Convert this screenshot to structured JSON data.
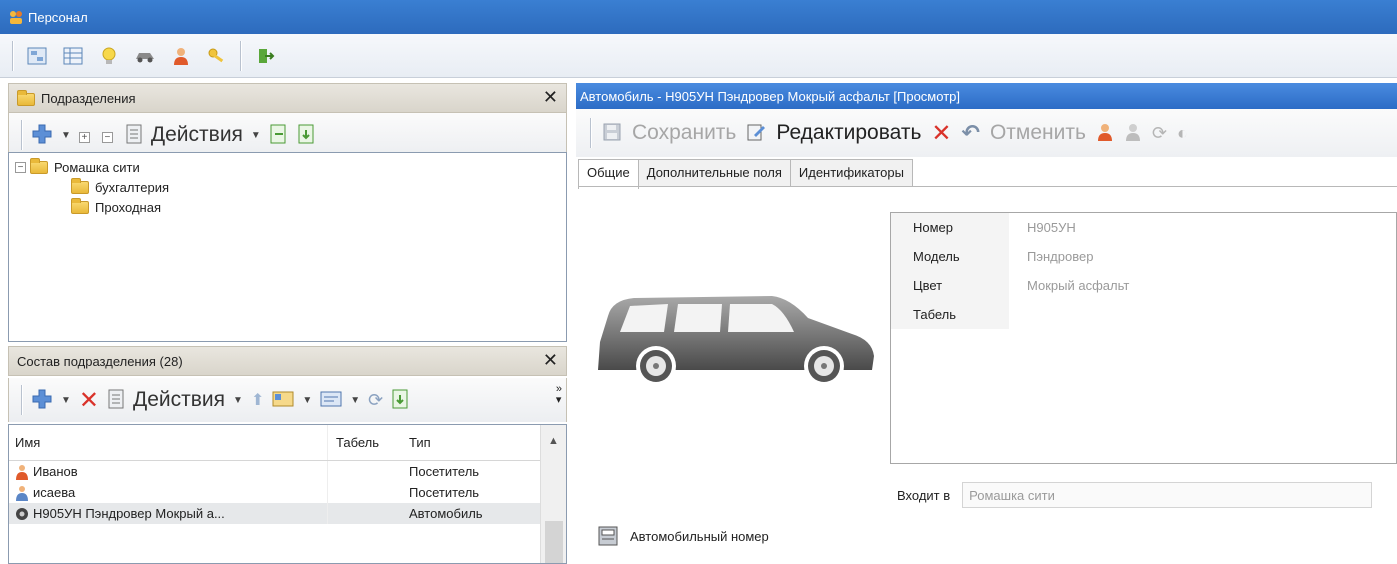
{
  "window": {
    "title": "Персонал"
  },
  "left_top_panel": {
    "title": "Подразделения",
    "actions_label": "Действия"
  },
  "tree": {
    "root": "Ромашка сити",
    "children": [
      "бухгалтерия",
      "Проходная"
    ]
  },
  "left_bottom_panel": {
    "title": "Состав подразделения (28)",
    "actions_label": "Действия"
  },
  "grid": {
    "columns": [
      "Имя",
      "Табель",
      "Тип"
    ],
    "rows": [
      {
        "name": "Иванов",
        "tabel": "",
        "type": "Посетитель",
        "icon": "person-icon"
      },
      {
        "name": "исаева",
        "tabel": "",
        "type": "Посетитель",
        "icon": "person-icon"
      },
      {
        "name": "Н905УН Пэндровер Мокрый а...",
        "tabel": "",
        "type": "Автомобиль",
        "icon": "vehicle-icon"
      }
    ]
  },
  "detail": {
    "header": "Автомобиль - Н905УН Пэндровер Мокрый асфальт [Просмотр]",
    "save_label": "Сохранить",
    "edit_label": "Редактировать",
    "cancel_label": "Отменить",
    "tabs": [
      "Общие",
      "Дополнительные поля",
      "Идентификаторы"
    ],
    "properties": [
      {
        "key": "Номер",
        "value": "Н905УН"
      },
      {
        "key": "Модель",
        "value": "Пэндровер"
      },
      {
        "key": "Цвет",
        "value": "Мокрый асфальт"
      },
      {
        "key": "Табель",
        "value": ""
      }
    ],
    "member_of_label": "Входит в",
    "member_of_value": "Ромашка сити",
    "plate_label": "Автомобильный номер"
  },
  "colors": {
    "titlebar": "#2d6bbd",
    "detail_header": "#2c6cc6",
    "delete": "#d9322a"
  }
}
